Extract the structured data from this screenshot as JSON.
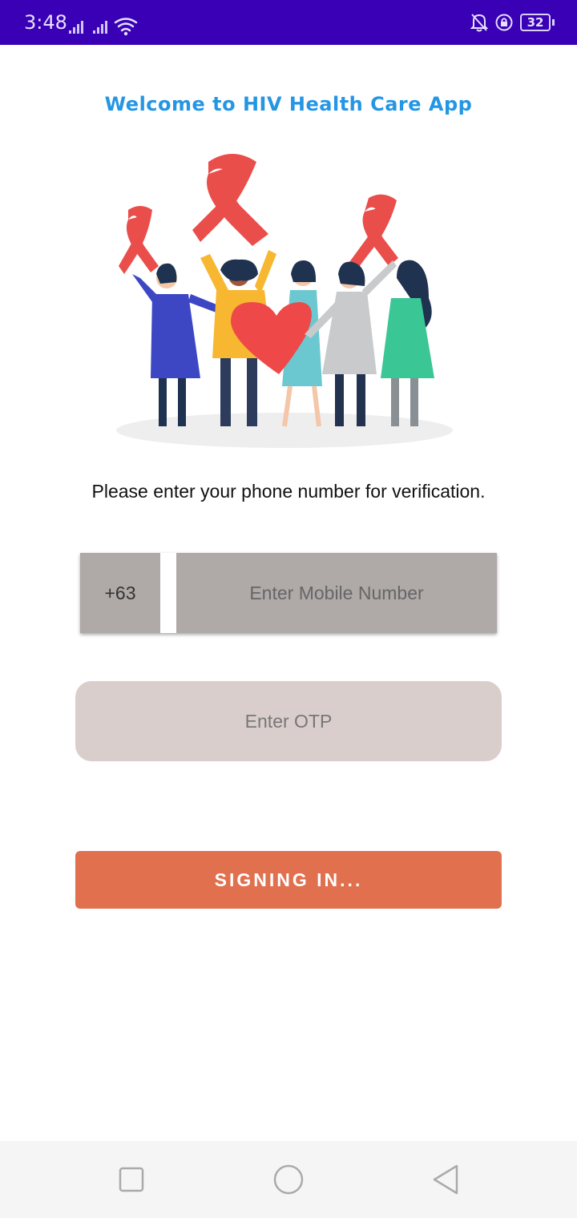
{
  "status_bar": {
    "time": "3:48",
    "battery": "32",
    "background": "#3a00b5"
  },
  "welcome": {
    "title": "Welcome to HIV Health Care App",
    "color": "#2496e4"
  },
  "instruction": "Please enter your phone number for verification.",
  "phone": {
    "country_code": "+63",
    "placeholder": "Enter Mobile Number"
  },
  "otp": {
    "placeholder": "Enter OTP"
  },
  "signin": {
    "label": "SIGNING IN...",
    "color": "#e0704e"
  },
  "nav": {
    "icons": [
      "recent-apps-icon",
      "home-icon",
      "back-icon"
    ]
  }
}
